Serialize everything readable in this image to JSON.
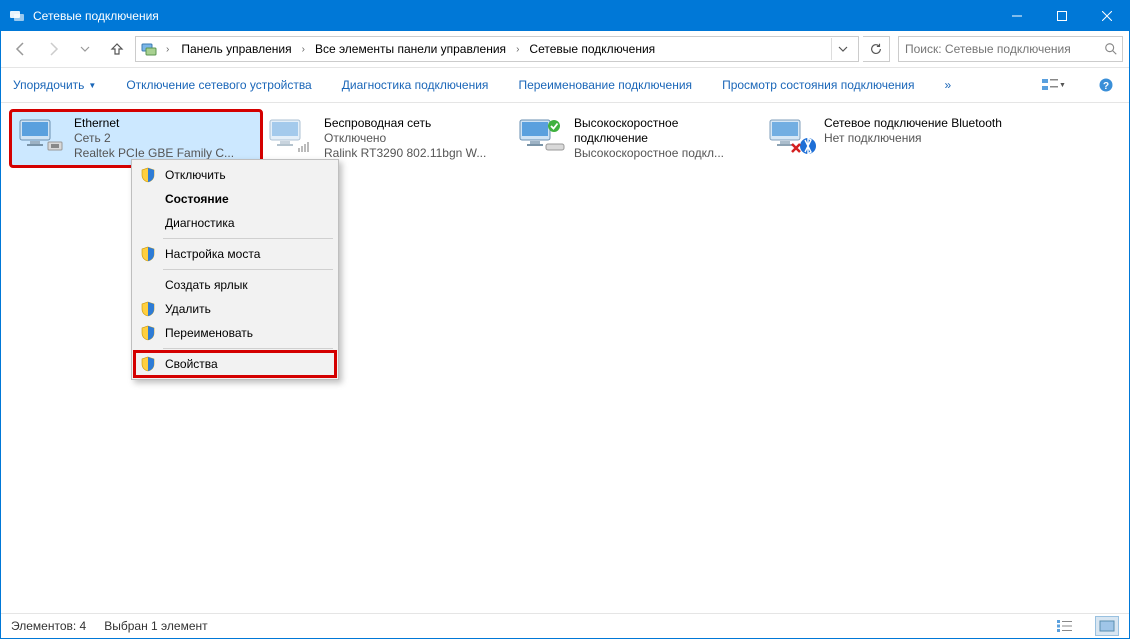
{
  "title": "Сетевые подключения",
  "breadcrumbs": {
    "root_icon": "network-folder",
    "items": [
      "Панель управления",
      "Все элементы панели управления",
      "Сетевые подключения"
    ]
  },
  "search": {
    "placeholder": "Поиск: Сетевые подключения"
  },
  "commands": {
    "organize": "Упорядочить",
    "disable": "Отключение сетевого устройства",
    "diagnose": "Диагностика подключения",
    "rename": "Переименование подключения",
    "status": "Просмотр состояния подключения"
  },
  "connections": [
    {
      "name": "Ethernet",
      "line2": "Сеть  2",
      "line3": "Realtek PCIe GBE Family C...",
      "selected": true,
      "highlighted": true,
      "icon": "ethernet"
    },
    {
      "name": "Беспроводная сеть",
      "line2": "Отключено",
      "line3": "Ralink RT3290 802.11bgn W...",
      "selected": false,
      "highlighted": false,
      "icon": "wifi-off"
    },
    {
      "name": "Высокоскоростное подключение",
      "line2": "",
      "line3": "Высокоскоростное подкл...",
      "selected": false,
      "highlighted": false,
      "icon": "ppp-ok"
    },
    {
      "name": "Сетевое подключение Bluetooth",
      "line2": "",
      "line3": "Нет подключения",
      "selected": false,
      "highlighted": false,
      "icon": "bt-x"
    }
  ],
  "context_menu": [
    {
      "label": "Отключить",
      "shield": true,
      "sep_after": false
    },
    {
      "label": "Состояние",
      "shield": false,
      "bold": true
    },
    {
      "label": "Диагностика",
      "shield": false,
      "sep_after": true
    },
    {
      "label": "Настройка моста",
      "shield": true,
      "sep_after": true
    },
    {
      "label": "Создать ярлык",
      "shield": false
    },
    {
      "label": "Удалить",
      "shield": true
    },
    {
      "label": "Переименовать",
      "shield": true,
      "sep_after": true
    },
    {
      "label": "Свойства",
      "shield": true,
      "highlighted": true
    }
  ],
  "statusbar": {
    "count_label": "Элементов: 4",
    "selection_label": "Выбран 1 элемент"
  }
}
